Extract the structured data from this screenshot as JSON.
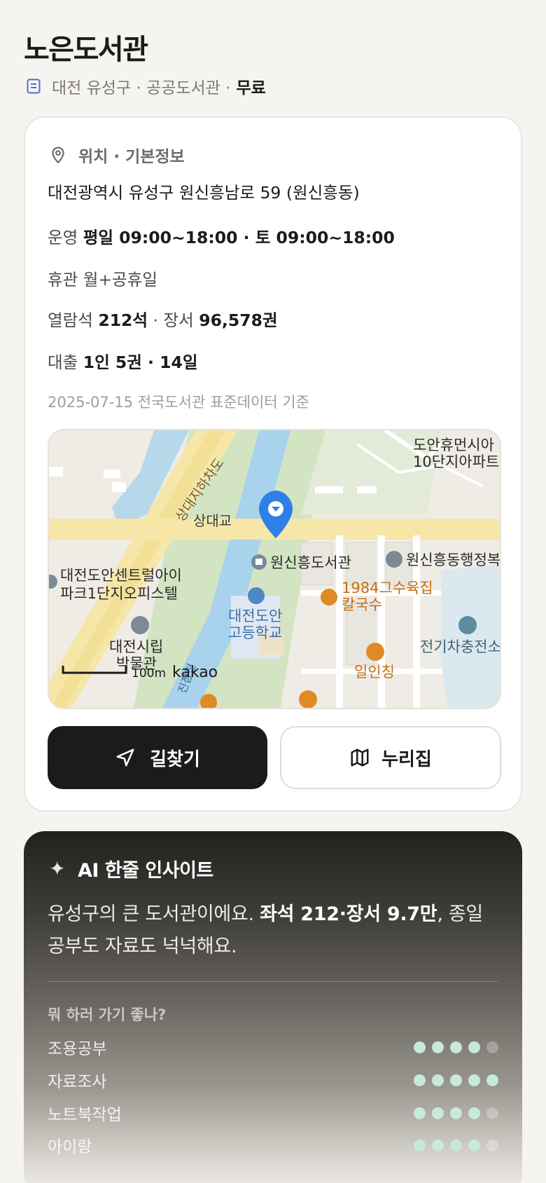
{
  "header": {
    "title": "노은도서관",
    "subtitle": "대전 유성구 · 공공도서관 · ",
    "fee": "무료"
  },
  "info": {
    "section_title": "위치 · 기본정보",
    "address": "대전광역시 유성구 원신흥남로 59 (원신흥동)",
    "hours_label": "운영",
    "hours_value": "평일 09:00~18:00 · 토 09:00~18:00",
    "closed_label": "휴관",
    "closed_value": "월+공휴일",
    "seats_label": "열람석",
    "seats_value": "212석",
    "books_label": "장서",
    "books_value": "96,578권",
    "loan_label": "대출",
    "loan_value": "1인 5권 · 14일",
    "source": "2025-07-15 전국도서관 표준데이터 기준"
  },
  "map": {
    "labels": {
      "road": "상대지하차도",
      "bridge": "상대교",
      "library": "원신흥도서관",
      "office": "대전도안센트럴아이",
      "office2": "파크1단지오피스텔",
      "museum": "대전시립",
      "museum2": "박물관",
      "school": "대전도안",
      "school2": "고등학교",
      "restaurant": "1984그수육집",
      "restaurant2": "칼국수",
      "cafe": "일인칭",
      "apartment": "도안휴먼시아",
      "apartment2": "10단지아파트",
      "community": "원신흥동행정복지센터",
      "charger": "전기차충전소",
      "stream": "진잠천"
    },
    "scale": "100m",
    "provider": "kakao"
  },
  "actions": {
    "directions": "길찾기",
    "website": "누리집"
  },
  "ai": {
    "title": "AI 한줄 인사이트",
    "text_before": "유성구의 큰 도서관이에요. ",
    "text_bold": "좌석 212·장서 9.7만",
    "text_after": ", 종일 공부도 자료도 넉넉해요.",
    "question": "뭐 하러 가기 좋나?",
    "activities": [
      {
        "name": "조용공부",
        "score": 4,
        "max": 5
      },
      {
        "name": "자료조사",
        "score": 5,
        "max": 5
      },
      {
        "name": "노트북작업",
        "score": 4,
        "max": 5
      },
      {
        "name": "아이랑",
        "score": 4,
        "max": 5
      }
    ]
  },
  "colors": {
    "accent_dark": "#1c1b19",
    "dot_on": "#c5e9dd",
    "map_pin": "#2f7fe8"
  }
}
